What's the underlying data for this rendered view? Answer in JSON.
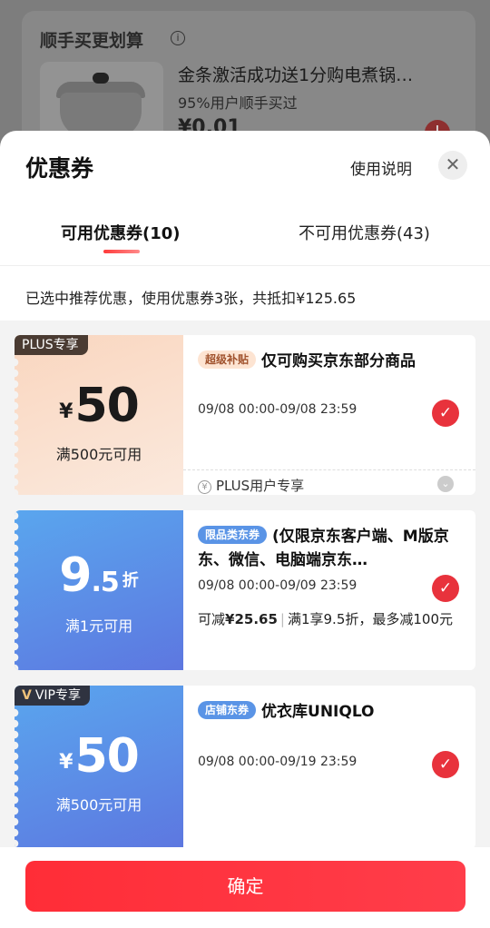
{
  "background": {
    "section_title": "顺手买更划算",
    "info_icon": "info-icon",
    "product_title": "金条激活成功送1分购电煮锅…",
    "product_sub": "95%用户顺手买过",
    "price": "¥0.01",
    "add_icon": "plus-icon"
  },
  "sheet": {
    "title": "优惠券",
    "usage_link": "使用说明",
    "close_icon": "close-icon",
    "tabs": [
      {
        "label": "可用优惠券(10)",
        "active": true
      },
      {
        "label": "不可用优惠券(43)",
        "active": false
      }
    ],
    "summary": "已选中推荐优惠，使用优惠券3张，共抵扣¥125.65"
  },
  "coupons": [
    {
      "badge": "PLUS专享",
      "currency": "¥",
      "amount": "50",
      "condition": "满500元可用",
      "tag": "超级补贴",
      "title": "仅可购买京东部分商品",
      "date": "09/08 00:00-09/08 23:59",
      "footer": "PLUS用户专享",
      "selected": true
    },
    {
      "amount_int": "9",
      "amount_dec": ".5",
      "unit": "折",
      "condition": "满1元可用",
      "tag": "限品类东券",
      "title": "(仅限京东客户端、M版京东、微信、电脑端京东…",
      "date": "09/08 00:00-09/09 23:59",
      "detail_prefix": "可减",
      "detail_amount": "¥25.65",
      "detail_rest": "满1享9.5折，最多减100元",
      "selected": true
    },
    {
      "badge": "VIP专享",
      "currency": "¥",
      "amount": "50",
      "condition": "满500元可用",
      "tag": "店铺东券",
      "title": "优衣库UNIQLO",
      "date": "09/08 00:00-09/19 23:59",
      "selected": true
    }
  ],
  "confirm_label": "确定",
  "colors": {
    "accent": "#e8323c",
    "button": "#ff2d37",
    "blue_coupon": "#5a8fe6",
    "plus_coupon": "#f9d6bf"
  }
}
